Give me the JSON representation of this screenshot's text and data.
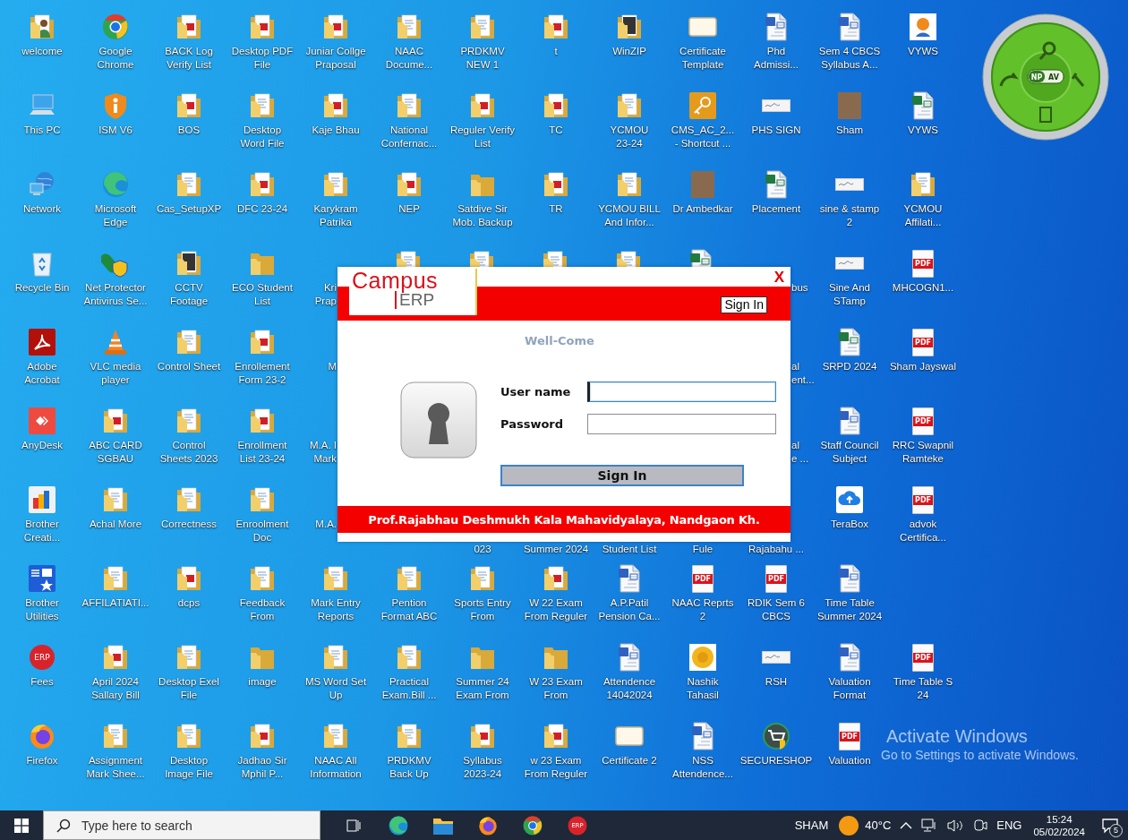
{
  "desktop": {
    "columns": [
      [
        {
          "kind": "user-folder",
          "label": "welcome"
        },
        {
          "kind": "pc",
          "label": "This PC"
        },
        {
          "kind": "network",
          "label": "Network"
        },
        {
          "kind": "recycle",
          "label": "Recycle Bin"
        },
        {
          "kind": "acrobat",
          "label": "Adobe\nAcrobat"
        },
        {
          "kind": "anydesk",
          "label": "AnyDesk"
        },
        {
          "kind": "brother",
          "label": "Brother\nCreati..."
        },
        {
          "kind": "brother-utilities",
          "label": "Brother\nUtilities"
        },
        {
          "kind": "erp",
          "label": "Fees",
          "badge": "ERP"
        },
        {
          "kind": "firefox",
          "label": "Firefox"
        }
      ],
      [
        {
          "kind": "chrome",
          "label": "Google\nChrome"
        },
        {
          "kind": "ism",
          "label": "ISM V6"
        },
        {
          "kind": "edge",
          "label": "Microsoft\nEdge"
        },
        {
          "kind": "npav",
          "label": "Net Protector\nAntivirus Se..."
        },
        {
          "kind": "vlc",
          "label": "VLC media\nplayer"
        },
        {
          "kind": "folder-pdf",
          "label": "ABC CARD\nSGBAU"
        },
        {
          "kind": "folder",
          "label": "Achal More"
        },
        {
          "kind": "folder",
          "label": "AFFILATIATI..."
        },
        {
          "kind": "folder-pdf",
          "label": "April 2024\nSallary Bill"
        },
        {
          "kind": "folder",
          "label": "Assignment\nMark Shee..."
        }
      ],
      [
        {
          "kind": "folder-pdf",
          "label": "BACK Log\nVerify List"
        },
        {
          "kind": "folder-pdf",
          "label": "BOS"
        },
        {
          "kind": "folder",
          "label": "Cas_SetupXP"
        },
        {
          "kind": "folder-dark",
          "label": "CCTV\nFootage"
        },
        {
          "kind": "folder",
          "label": "Control Sheet"
        },
        {
          "kind": "folder",
          "label": "Control\nSheets 2023"
        },
        {
          "kind": "folder",
          "label": "Correctness"
        },
        {
          "kind": "folder-pdf",
          "label": "dcps"
        },
        {
          "kind": "folder",
          "label": "Desktop Exel\nFile"
        },
        {
          "kind": "folder",
          "label": "Desktop\nImage File"
        }
      ],
      [
        {
          "kind": "folder-pdf",
          "label": "Desktop PDF\nFile"
        },
        {
          "kind": "folder",
          "label": "Desktop\nWord File"
        },
        {
          "kind": "folder-pdf",
          "label": "DFC 23-24"
        },
        {
          "kind": "folder-plain",
          "label": "ECO Student\nList"
        },
        {
          "kind": "folder-pdf",
          "label": "Enrollement\nForm 23-2"
        },
        {
          "kind": "folder-pdf",
          "label": "Enrollment\nList 23-24"
        },
        {
          "kind": "folder",
          "label": "Enroolment\nDoc"
        },
        {
          "kind": "folder",
          "label": "Feedback\nFrom"
        },
        {
          "kind": "folder-plain",
          "label": "image"
        },
        {
          "kind": "folder-pdf",
          "label": "Jadhao Sir\nMphil P..."
        }
      ],
      [
        {
          "kind": "folder-pdf",
          "label": "Juniar Collge\nPraposal"
        },
        {
          "kind": "folder-pdf",
          "label": "Kaje Bhau"
        },
        {
          "kind": "folder",
          "label": "Karykram\nPatrika"
        },
        {
          "kind": "cut-left",
          "label": "Kri\nPrap"
        },
        {
          "kind": "cut-left",
          "label": "M"
        },
        {
          "kind": "cut-left",
          "label": "M.A. I\nMark"
        },
        {
          "kind": "cut-left",
          "label": "M.A."
        },
        {
          "kind": "folder",
          "label": "Mark Entry\nReports"
        },
        {
          "kind": "folder",
          "label": "MS Word Set\nUp"
        },
        {
          "kind": "folder",
          "label": "NAAC All\nInformation"
        }
      ],
      [
        {
          "kind": "folder",
          "label": "NAAC\nDocume..."
        },
        {
          "kind": "folder",
          "label": "National\nConfernac..."
        },
        {
          "kind": "folder-pdf",
          "label": "NEP"
        },
        {
          "kind": "peek-folder"
        },
        {
          "kind": "blank"
        },
        {
          "kind": "blank"
        },
        {
          "kind": "blank"
        },
        {
          "kind": "folder",
          "label": "Pention\nFormat ABC"
        },
        {
          "kind": "folder",
          "label": "Practical\nExam.Bill ..."
        },
        {
          "kind": "folder",
          "label": "PRDKMV\nBack Up"
        }
      ],
      [
        {
          "kind": "folder",
          "label": "PRDKMV\nNEW 1"
        },
        {
          "kind": "folder-pdf",
          "label": "Reguler Verify\nList"
        },
        {
          "kind": "folder-plain",
          "label": "Satdive Sir\nMob. Backup"
        },
        {
          "kind": "peek-folder"
        },
        {
          "kind": "blank"
        },
        {
          "kind": "blank"
        },
        {
          "kind": "cut-top",
          "label": "023"
        },
        {
          "kind": "folder",
          "label": "Sports Entry\nFrom"
        },
        {
          "kind": "folder-plain",
          "label": "Summer 24\nExam From"
        },
        {
          "kind": "folder-pdf",
          "label": "Syllabus\n2023-24"
        }
      ],
      [
        {
          "kind": "folder-pdf",
          "label": "t"
        },
        {
          "kind": "folder-pdf",
          "label": "TC"
        },
        {
          "kind": "folder-pdf",
          "label": "TR"
        },
        {
          "kind": "peek-folder"
        },
        {
          "kind": "blank"
        },
        {
          "kind": "blank"
        },
        {
          "kind": "cut-top",
          "label": "Summer 2024"
        },
        {
          "kind": "folder-pdf",
          "label": "W 22 Exam\nFrom Reguler"
        },
        {
          "kind": "folder-plain",
          "label": "W 23 Exam\nFrom"
        },
        {
          "kind": "folder-pdf",
          "label": "w 23 Exam\nFrom Reguler"
        }
      ],
      [
        {
          "kind": "folder-dark",
          "label": "WinZIP"
        },
        {
          "kind": "folder",
          "label": "YCMOU\n23-24"
        },
        {
          "kind": "folder",
          "label": "YCMOU BILL\nAnd Infor..."
        },
        {
          "kind": "peek-folder"
        },
        {
          "kind": "blank"
        },
        {
          "kind": "blank"
        },
        {
          "kind": "cut-top",
          "label": "Student List"
        },
        {
          "kind": "word",
          "label": "A.P.Patil\nPension Ca..."
        },
        {
          "kind": "word",
          "label": "Attendence\n14042024"
        },
        {
          "kind": "blank-card",
          "label": "Certificate 2"
        }
      ],
      [
        {
          "kind": "blank-card",
          "label": "Certificate\nTemplate"
        },
        {
          "kind": "key",
          "label": "CMS_AC_2...\n- Shortcut ..."
        },
        {
          "kind": "photo",
          "label": "Dr Ambedkar"
        },
        {
          "kind": "peek-excel"
        },
        {
          "kind": "blank"
        },
        {
          "kind": "blank"
        },
        {
          "kind": "cut-top",
          "label": "Fule"
        },
        {
          "kind": "pdf",
          "label": "NAAC Reprts\n2",
          "badge": "PDF"
        },
        {
          "kind": "seal",
          "label": "Nashik\nTahasil"
        },
        {
          "kind": "word",
          "label": "NSS\nAttendence..."
        }
      ],
      [
        {
          "kind": "word",
          "label": "Phd\nAdmissi..."
        },
        {
          "kind": "sign",
          "label": "PHS SIGN"
        },
        {
          "kind": "excel",
          "label": "Placement"
        },
        {
          "kind": "cut-right",
          "label": "bus"
        },
        {
          "kind": "cut-right",
          "label": "al\nent..."
        },
        {
          "kind": "cut-right",
          "label": "al\ne ..."
        },
        {
          "kind": "cut-top",
          "label": "Rajabahu ..."
        },
        {
          "kind": "pdf",
          "label": "RDIK Sem 6\nCBCS",
          "badge": "PDF"
        },
        {
          "kind": "sign",
          "label": "RSH"
        },
        {
          "kind": "secureshop",
          "label": "SECURESHOP"
        }
      ],
      [
        {
          "kind": "word",
          "label": "Sem 4 CBCS\nSyllabus A..."
        },
        {
          "kind": "photo",
          "label": "Sham"
        },
        {
          "kind": "sign",
          "label": "sine & stamp\n2"
        },
        {
          "kind": "sign",
          "label": "Sine And\nSTamp"
        },
        {
          "kind": "excel",
          "label": "SRPD 2024"
        },
        {
          "kind": "word",
          "label": "Staff Council\nSubject"
        },
        {
          "kind": "terabox",
          "label": "TeraBox"
        },
        {
          "kind": "word",
          "label": "Time Table\nSummer 2024"
        },
        {
          "kind": "word",
          "label": "Valuation\nFormat"
        },
        {
          "kind": "pdf",
          "label": "Valuation",
          "badge": "PDF"
        }
      ],
      [
        {
          "kind": "emblem",
          "label": "VYWS"
        },
        {
          "kind": "excel",
          "label": "VYWS"
        },
        {
          "kind": "folder",
          "label": "YCMOU\nAffilati..."
        },
        {
          "kind": "pdf",
          "label": "MHCOGN1...",
          "badge": "PDF"
        },
        {
          "kind": "pdf",
          "label": "Sham Jayswal",
          "badge": "PDF"
        },
        {
          "kind": "pdf",
          "label": "RRC Swapnil\nRamteke",
          "badge": "PDF"
        },
        {
          "kind": "pdf",
          "label": "advok\nCertifica...",
          "badge": "PDF"
        },
        {
          "kind": "blank"
        },
        {
          "kind": "pdf",
          "label": "Time Table S\n24",
          "badge": "PDF"
        },
        {
          "kind": "blank"
        }
      ]
    ]
  },
  "antivirus_widget": {
    "labels": [
      "NP",
      "AV"
    ]
  },
  "dialog": {
    "logo_top": "Campus",
    "logo_bottom": "ERP",
    "close": "X",
    "header_button": "Sign In",
    "greeting": "Well-Come",
    "fields": [
      {
        "label": "User name",
        "focused": true
      },
      {
        "label": "Password",
        "focused": false
      }
    ],
    "submit": "Sign In",
    "footer": "Prof.Rajabhau Deshmukh Kala Mahavidyalaya, Nandgaon Kh."
  },
  "activation_notice": {
    "title": "Activate Windows",
    "subtitle": "Go to Settings to activate Windows."
  },
  "taskbar": {
    "search_placeholder": "Type here to search",
    "pinned": [
      {
        "kind": "task-view"
      },
      {
        "kind": "edge"
      },
      {
        "kind": "explorer"
      },
      {
        "kind": "firefox"
      },
      {
        "kind": "chrome"
      },
      {
        "kind": "erp",
        "badge": "ERP"
      }
    ],
    "user": "SHAM",
    "weather": "40°C",
    "language": "ENG",
    "time": "15:24",
    "date": "05/02/2024",
    "notifications": "5"
  }
}
